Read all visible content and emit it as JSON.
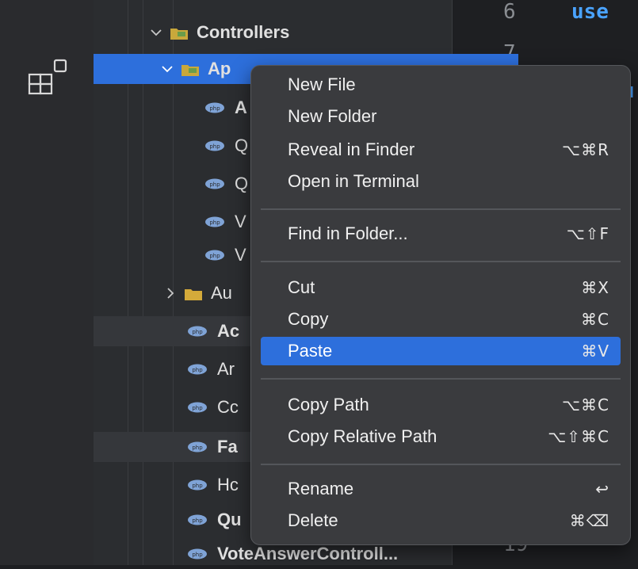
{
  "editor": {
    "line_numbers": [
      "6",
      "7",
      "19"
    ],
    "code_fragment": "use",
    "code_fragment2": "u"
  },
  "tree": {
    "items": [
      {
        "label": "Controllers",
        "type": "folder"
      },
      {
        "label": "Ap",
        "type": "folder"
      },
      {
        "label": "A",
        "type": "file"
      },
      {
        "label": "Q",
        "type": "file"
      },
      {
        "label": "Q",
        "type": "file"
      },
      {
        "label": "V",
        "type": "file"
      },
      {
        "label": "V",
        "type": "file"
      },
      {
        "label": "Au",
        "type": "folder"
      },
      {
        "label": "Ac",
        "type": "file"
      },
      {
        "label": "Ar",
        "type": "file"
      },
      {
        "label": "Cc",
        "type": "file"
      },
      {
        "label": "Fa",
        "type": "file"
      },
      {
        "label": "Hc",
        "type": "file"
      },
      {
        "label": "Qu",
        "type": "file"
      },
      {
        "label": "VoteAnswerControll...",
        "type": "file"
      }
    ]
  },
  "context_menu": {
    "items": [
      {
        "label": "New File",
        "shortcut": ""
      },
      {
        "label": "New Folder",
        "shortcut": ""
      },
      {
        "label": "Reveal in Finder",
        "shortcut": "⌥⌘R"
      },
      {
        "label": "Open in Terminal",
        "shortcut": ""
      },
      {
        "label": "Find in Folder...",
        "shortcut": "⌥⇧F"
      },
      {
        "label": "Cut",
        "shortcut": "⌘X"
      },
      {
        "label": "Copy",
        "shortcut": "⌘C"
      },
      {
        "label": "Paste",
        "shortcut": "⌘V"
      },
      {
        "label": "Copy Path",
        "shortcut": "⌥⌘C"
      },
      {
        "label": "Copy Relative Path",
        "shortcut": "⌥⇧⌘C"
      },
      {
        "label": "Rename",
        "shortcut": "↩"
      },
      {
        "label": "Delete",
        "shortcut": "⌘⌫"
      }
    ]
  },
  "colors": {
    "selection": "#2d6fdc",
    "menu_bg": "#3a3b3e",
    "code_keyword": "#4aa3ff"
  }
}
